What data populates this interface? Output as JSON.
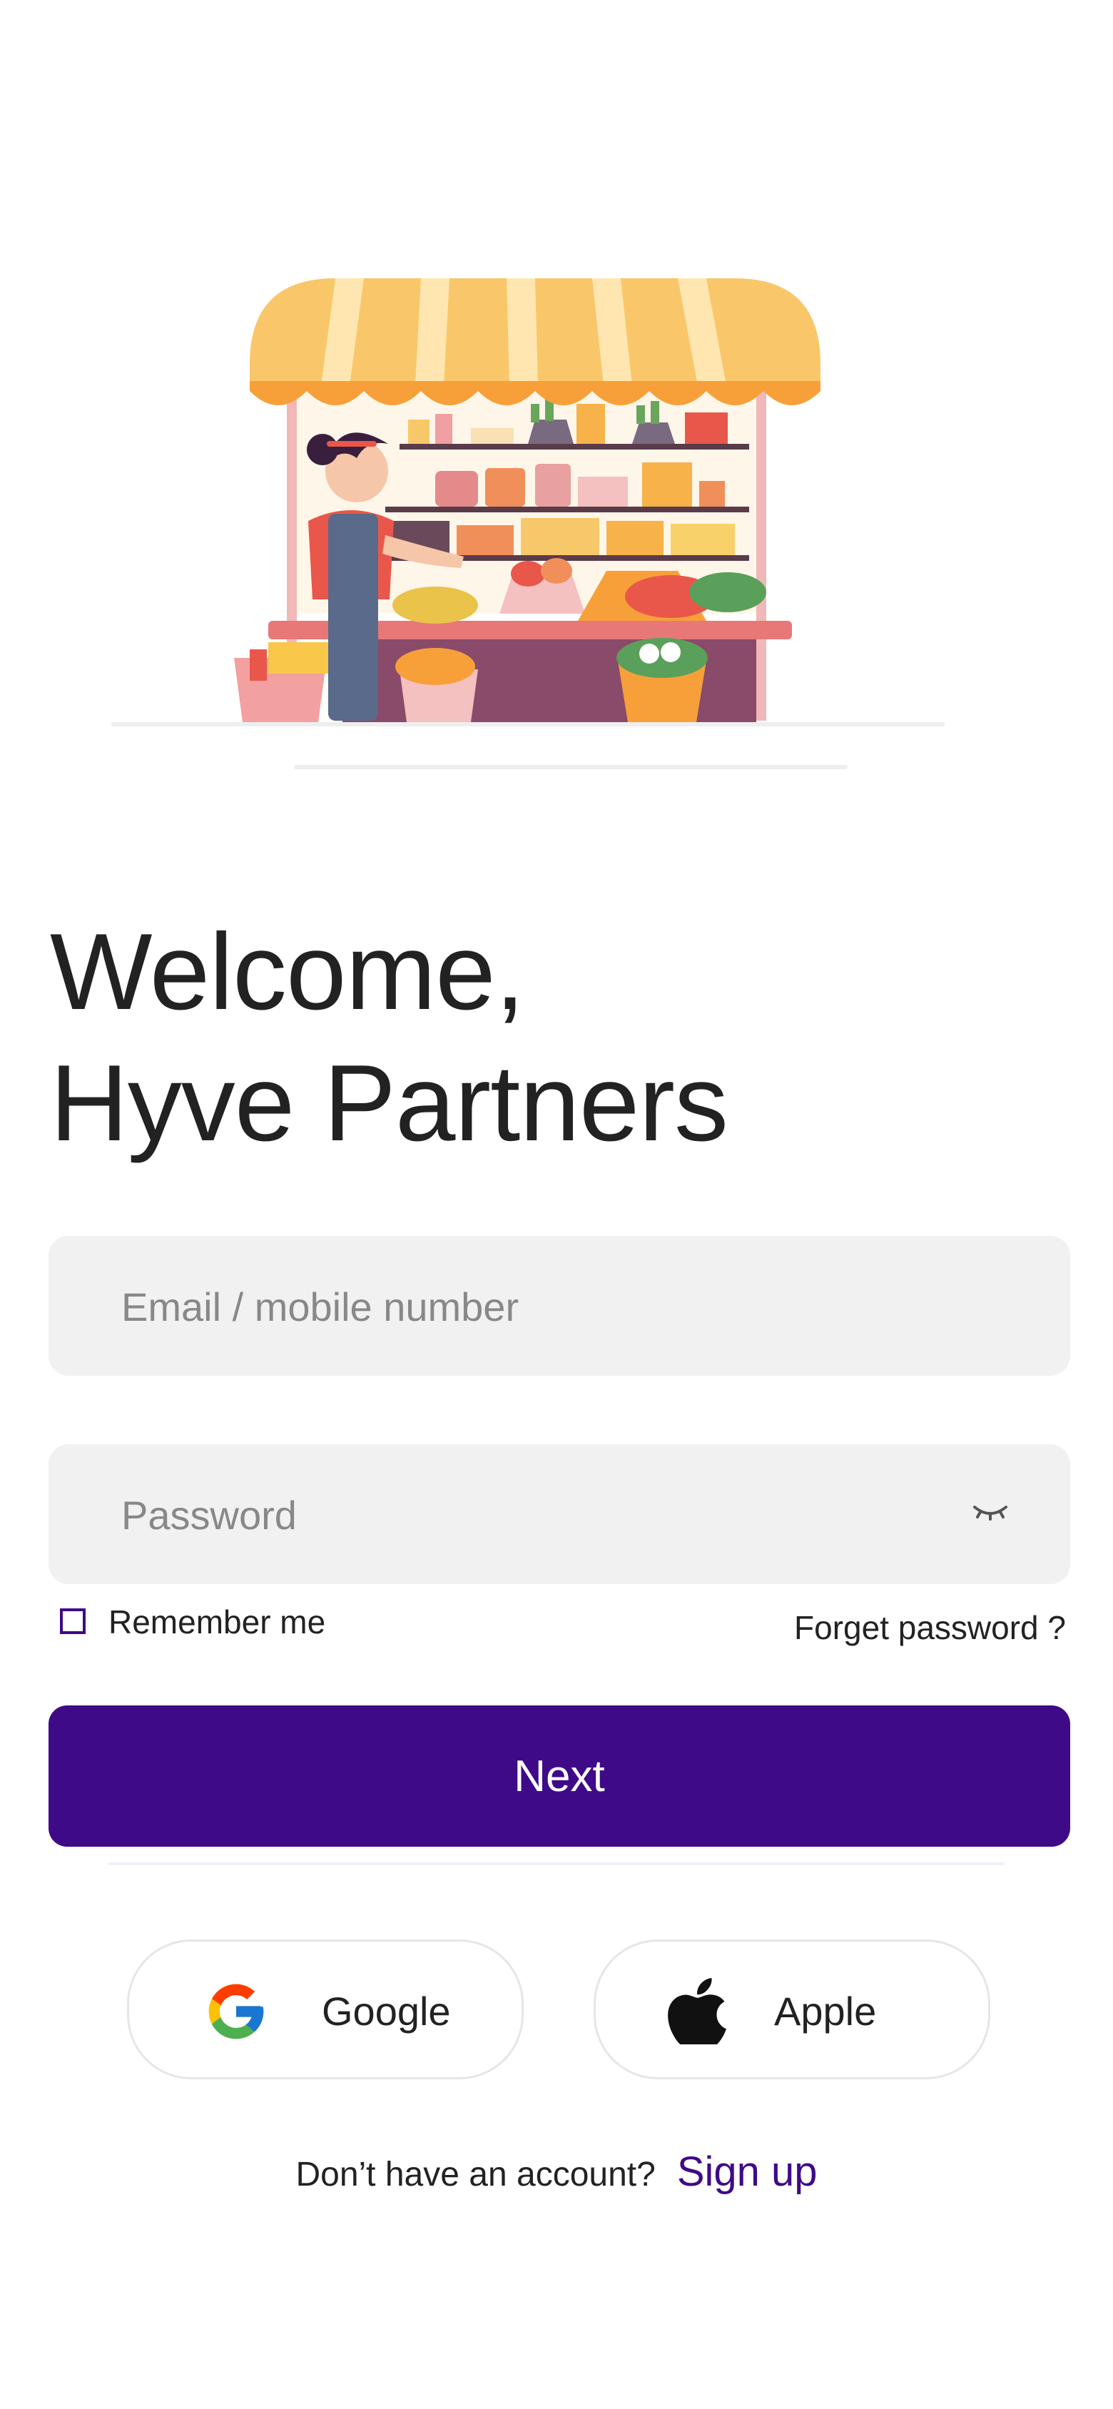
{
  "hero": {
    "illustration": "market-stall-vendor-illustration"
  },
  "welcome": {
    "line1": "Welcome,",
    "line2": "Hyve Partners"
  },
  "form": {
    "email_placeholder": "Email / mobile number",
    "password_placeholder": "Password",
    "password_toggle_icon": "eye-closed-icon",
    "remember_label": "Remember me",
    "remember_checked": false,
    "forgot_label": "Forget password ?",
    "next_label": "Next"
  },
  "social": {
    "google_label": "Google",
    "apple_label": "Apple"
  },
  "footer": {
    "question": "Don’t have an account?",
    "signup_label": "Sign up"
  },
  "colors": {
    "primary": "#3f0a87",
    "field_bg": "#f1f1f1",
    "text": "#222222",
    "placeholder": "#888888"
  }
}
